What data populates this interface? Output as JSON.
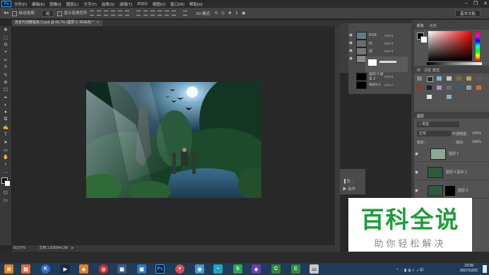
{
  "app": {
    "logo": "Ps"
  },
  "menu": [
    "文件(F)",
    "编辑(E)",
    "图像(I)",
    "图层(L)",
    "文字(Y)",
    "选择(S)",
    "滤镜(T)",
    "3D(D)",
    "视图(V)",
    "窗口(W)",
    "帮助(H)"
  ],
  "window_controls": [
    "–",
    "❐",
    "✕"
  ],
  "options": {
    "auto_select": "自动选择：",
    "auto_select_value": "组",
    "show_transform": "显示变换控件",
    "workspace": "基本功能"
  },
  "document": {
    "tab": "改变光线教程练习.psd @ 66.7% (图层 0, RGB/8) *",
    "close": "×"
  },
  "status": {
    "zoom": "66.67%",
    "doc_size": "文档:1.82M/44.3M"
  },
  "tools": [
    "✥",
    "⬚",
    "ʘ",
    "⌖",
    "✂",
    "⌾",
    "✎",
    "⊕",
    "☐",
    "✒",
    "◐",
    "●",
    "⧉",
    "✍",
    "T",
    "➤",
    "▭",
    "✋",
    "⌕",
    "⋯"
  ],
  "channels": {
    "rows": [
      {
        "name": "RGB",
        "key": "Ctrl+2"
      },
      {
        "name": "红",
        "key": "Ctrl+3"
      },
      {
        "name": "绿",
        "key": "Ctrl+4"
      },
      {
        "name": "蓝",
        "key": "Ctrl+5"
      },
      {
        "name": "图层 0 副本 2",
        "key": "Ctrl+6"
      },
      {
        "name": "Alpha 1",
        "key": "Ctrl+7"
      }
    ]
  },
  "actions": {
    "item1": "历...",
    "item2": "动作"
  },
  "color_panel": {
    "tab1": "颜色",
    "tab2": "色板"
  },
  "adjust_panel": {
    "tab1": "库",
    "tab2": "调整",
    "tab3": "样式"
  },
  "layers": {
    "tab": "图层",
    "kind": "类型",
    "blend": "正常",
    "opacity_label": "不透明度:",
    "opacity": "100%",
    "lock": "锁定:",
    "fill_label": "填充:",
    "fill": "100%",
    "rows": [
      {
        "name": "图层 1"
      },
      {
        "name": "图层 0 副本 2"
      },
      {
        "name": "图层 0"
      }
    ]
  },
  "watermark": {
    "title": "百科全说",
    "subtitle": "助你轻松解决"
  },
  "taskbar": {
    "time": "19:39",
    "date": "2017/12/22",
    "ps_label": "Ps"
  }
}
